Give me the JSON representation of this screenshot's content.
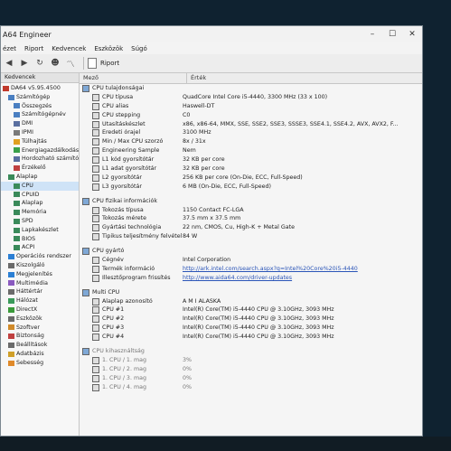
{
  "window": {
    "title": "A64 Engineer",
    "controls": [
      "–",
      "☐",
      "✕"
    ]
  },
  "menu": [
    "ézet",
    "Riport",
    "Kedvencek",
    "Eszközök",
    "Súgó"
  ],
  "toolbar": {
    "icons": [
      "back-icon",
      "forward-icon",
      "refresh-icon",
      "user-icon",
      "chart-icon"
    ],
    "report_label": "Riport"
  },
  "sidebar": {
    "header": "Kedvencek",
    "items": [
      {
        "label": "DA64 v5.95.4500",
        "indent": 0,
        "icon": "app-icon",
        "color": "#c0392b"
      },
      {
        "label": "Számítógép",
        "indent": 1,
        "icon": "computer-icon",
        "color": "#4a7fc1"
      },
      {
        "label": "Összegzés",
        "indent": 2,
        "icon": "summary-icon",
        "color": "#4a7fc1"
      },
      {
        "label": "Számítógépnév",
        "indent": 2,
        "icon": "computer-icon",
        "color": "#4a7fc1"
      },
      {
        "label": "DMI",
        "indent": 2,
        "icon": "dmi-icon",
        "color": "#5a6fa0"
      },
      {
        "label": "IPMI",
        "indent": 2,
        "icon": "ipmi-icon",
        "color": "#7a7a7a"
      },
      {
        "label": "Túlhajtás",
        "indent": 2,
        "icon": "overclock-icon",
        "color": "#e0a020"
      },
      {
        "label": "Energiagazdálkodás",
        "indent": 2,
        "icon": "power-icon",
        "color": "#3aa04a"
      },
      {
        "label": "Hordozható számítógép",
        "indent": 2,
        "icon": "laptop-icon",
        "color": "#5a6fa0"
      },
      {
        "label": "Érzékelő",
        "indent": 2,
        "icon": "sensor-icon",
        "color": "#c04040"
      },
      {
        "label": "Alaplap",
        "indent": 1,
        "icon": "motherboard-icon",
        "color": "#3a8a5a"
      },
      {
        "label": "CPU",
        "indent": 2,
        "icon": "cpu-icon",
        "color": "#3a8a5a",
        "selected": true
      },
      {
        "label": "CPUID",
        "indent": 2,
        "icon": "cpuid-icon",
        "color": "#3a8a5a"
      },
      {
        "label": "Alaplap",
        "indent": 2,
        "icon": "motherboard-icon",
        "color": "#3a8a5a"
      },
      {
        "label": "Memória",
        "indent": 2,
        "icon": "memory-icon",
        "color": "#3a8a5a"
      },
      {
        "label": "SPD",
        "indent": 2,
        "icon": "spd-icon",
        "color": "#3a8a5a"
      },
      {
        "label": "Lapkakészlet",
        "indent": 2,
        "icon": "chipset-icon",
        "color": "#3a8a5a"
      },
      {
        "label": "BIOS",
        "indent": 2,
        "icon": "bios-icon",
        "color": "#3a8a5a"
      },
      {
        "label": "ACPI",
        "indent": 2,
        "icon": "acpi-icon",
        "color": "#3a8a5a"
      },
      {
        "label": "Operációs rendszer",
        "indent": 1,
        "icon": "windows-icon",
        "color": "#2a7fd4"
      },
      {
        "label": "Kiszolgáló",
        "indent": 1,
        "icon": "server-icon",
        "color": "#6a6a6a"
      },
      {
        "label": "Megjelenítés",
        "indent": 1,
        "icon": "display-icon",
        "color": "#2a7fd4"
      },
      {
        "label": "Multimédia",
        "indent": 1,
        "icon": "multimedia-icon",
        "color": "#8a5ac0"
      },
      {
        "label": "Háttértár",
        "indent": 1,
        "icon": "storage-icon",
        "color": "#6a6a6a"
      },
      {
        "label": "Hálózat",
        "indent": 1,
        "icon": "network-icon",
        "color": "#3a9a5a"
      },
      {
        "label": "DirectX",
        "indent": 1,
        "icon": "directx-icon",
        "color": "#3a9a3a"
      },
      {
        "label": "Eszközök",
        "indent": 1,
        "icon": "devices-icon",
        "color": "#6a6a6a"
      },
      {
        "label": "Szoftver",
        "indent": 1,
        "icon": "software-icon",
        "color": "#d08a2a"
      },
      {
        "label": "Biztonság",
        "indent": 1,
        "icon": "security-icon",
        "color": "#c04040"
      },
      {
        "label": "Beállítások",
        "indent": 1,
        "icon": "settings-icon",
        "color": "#6a6a6a"
      },
      {
        "label": "Adatbázis",
        "indent": 1,
        "icon": "database-icon",
        "color": "#d0a02a"
      },
      {
        "label": "Sebesség",
        "indent": 1,
        "icon": "speed-icon",
        "color": "#e08a2a"
      }
    ]
  },
  "columns": {
    "field": "Mező",
    "value": "Érték"
  },
  "sections": [
    {
      "title": "CPU tulajdonságai",
      "rows": [
        {
          "field": "CPU típusa",
          "value": "QuadCore Intel Core i5-4440, 3300 MHz (33 x 100)"
        },
        {
          "field": "CPU alias",
          "value": "Haswell-DT"
        },
        {
          "field": "CPU stepping",
          "value": "C0"
        },
        {
          "field": "Utasításkészlet",
          "value": "x86, x86-64, MMX, SSE, SSE2, SSE3, SSSE3, SSE4.1, SSE4.2, AVX, AVX2, F..."
        },
        {
          "field": "Eredeti órajel",
          "value": "3100 MHz"
        },
        {
          "field": "Min / Max CPU szorzó",
          "value": "8x / 31x"
        },
        {
          "field": "Engineering Sample",
          "value": "Nem"
        },
        {
          "field": "L1 kód gyorsítótár",
          "value": "32 KB per core"
        },
        {
          "field": "L1 adat gyorsítótár",
          "value": "32 KB per core"
        },
        {
          "field": "L2 gyorsítótár",
          "value": "256 KB per core  (On-Die, ECC, Full-Speed)"
        },
        {
          "field": "L3 gyorsítótár",
          "value": "6 MB  (On-Die, ECC, Full-Speed)"
        }
      ]
    },
    {
      "title": "CPU fizikai információk",
      "rows": [
        {
          "field": "Tokozás típusa",
          "value": "1150 Contact FC-LGA"
        },
        {
          "field": "Tokozás mérete",
          "value": "37.5 mm x 37.5 mm"
        },
        {
          "field": "Gyártási technológia",
          "value": "22 nm, CMOS, Cu, High-K + Metal Gate"
        },
        {
          "field": "Tipikus teljesítmény felvétel",
          "value": "84 W"
        }
      ]
    },
    {
      "title": "CPU gyártó",
      "rows": [
        {
          "field": "Cégnév",
          "value": "Intel Corporation"
        },
        {
          "field": "Termék információ",
          "value": "http://ark.intel.com/search.aspx?q=Intel%20Core%20i5-4440",
          "link": true
        },
        {
          "field": "Illesztőprogram frissítés",
          "value": "http://www.aida64.com/driver-updates",
          "link": true
        }
      ]
    },
    {
      "title": "Multi CPU",
      "rows": [
        {
          "field": "Alaplap azonosító",
          "value": "A M I ALASKA"
        },
        {
          "field": "CPU #1",
          "value": "Intel(R) Core(TM) i5-4440 CPU @ 3.10GHz, 3093 MHz"
        },
        {
          "field": "CPU #2",
          "value": "Intel(R) Core(TM) i5-4440 CPU @ 3.10GHz, 3093 MHz"
        },
        {
          "field": "CPU #3",
          "value": "Intel(R) Core(TM) i5-4440 CPU @ 3.10GHz, 3093 MHz"
        },
        {
          "field": "CPU #4",
          "value": "Intel(R) Core(TM) i5-4440 CPU @ 3.10GHz, 3093 MHz"
        }
      ]
    },
    {
      "title": "CPU kihasználtság",
      "faded": true,
      "rows": [
        {
          "field": "1. CPU / 1. mag",
          "value": "3%"
        },
        {
          "field": "1. CPU / 2. mag",
          "value": "0%"
        },
        {
          "field": "1. CPU / 3. mag",
          "value": "0%"
        },
        {
          "field": "1. CPU / 4. mag",
          "value": "0%"
        }
      ]
    }
  ]
}
